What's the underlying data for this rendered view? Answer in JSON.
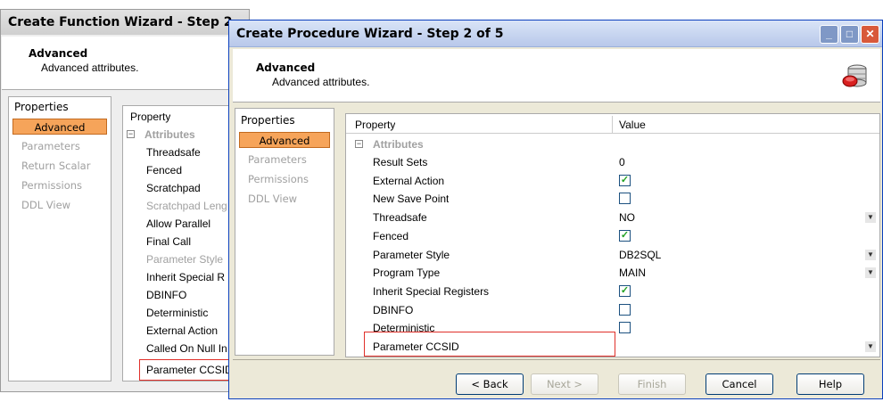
{
  "back_window": {
    "title": "Create Function Wizard - Step 2",
    "header": {
      "title": "Advanced",
      "subtitle": "Advanced attributes."
    },
    "nav": {
      "heading": "Properties",
      "items": [
        "Advanced",
        "Parameters",
        "Return Scalar",
        "Permissions",
        "DDL View"
      ]
    },
    "grid": {
      "column_header": "Property",
      "group": "Attributes",
      "rows": [
        "Threadsafe",
        "Fenced",
        "Scratchpad",
        "Scratchpad Leng",
        "Allow Parallel",
        "Final Call",
        "Parameter Style",
        "Inherit Special R",
        "DBINFO",
        "Deterministic",
        "External Action",
        "Called On Null In",
        "Parameter CCSID"
      ]
    }
  },
  "front_window": {
    "title": "Create Procedure Wizard - Step 2 of 5",
    "header": {
      "title": "Advanced",
      "subtitle": "Advanced attributes."
    },
    "nav": {
      "heading": "Properties",
      "items": [
        "Advanced",
        "Parameters",
        "Permissions",
        "DDL View"
      ]
    },
    "grid": {
      "column_property": "Property",
      "column_value": "Value",
      "group": "Attributes",
      "rows": [
        {
          "label": "Result Sets",
          "type": "text",
          "value": "0"
        },
        {
          "label": "External Action",
          "type": "check",
          "checked": true
        },
        {
          "label": "New Save Point",
          "type": "check",
          "checked": false
        },
        {
          "label": "Threadsafe",
          "type": "dropdown",
          "value": "NO"
        },
        {
          "label": "Fenced",
          "type": "check",
          "checked": true
        },
        {
          "label": "Parameter Style",
          "type": "dropdown",
          "value": "DB2SQL"
        },
        {
          "label": "Program Type",
          "type": "dropdown",
          "value": "MAIN"
        },
        {
          "label": "Inherit Special Registers",
          "type": "check",
          "checked": true
        },
        {
          "label": "DBINFO",
          "type": "check",
          "checked": false
        },
        {
          "label": "Deterministic",
          "type": "check",
          "checked": false
        },
        {
          "label": "Parameter CCSID",
          "type": "dropdown",
          "value": ""
        }
      ]
    },
    "buttons": {
      "back": "< Back",
      "next": "Next >",
      "finish": "Finish",
      "cancel": "Cancel",
      "help": "Help"
    }
  },
  "colors": {
    "title_blue": "#0a5bd9",
    "nav_active": "#f6a45a",
    "highlight_red": "#e0302a",
    "check_green": "#21a121"
  }
}
